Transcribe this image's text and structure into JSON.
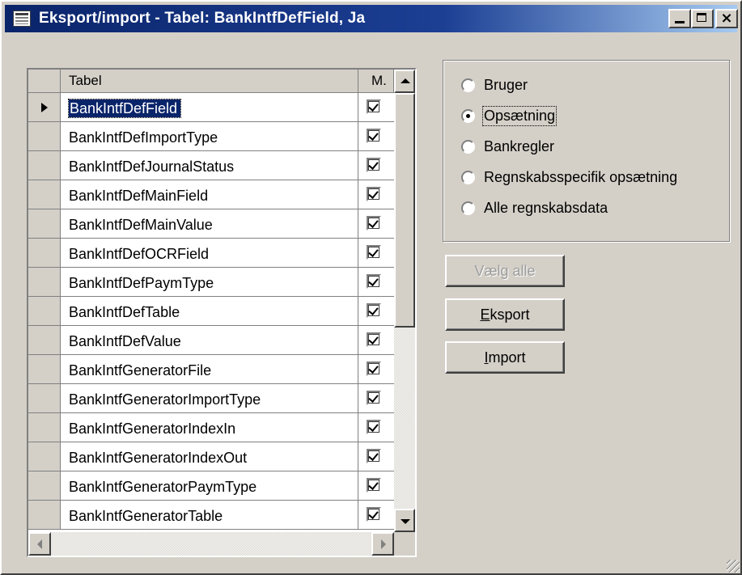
{
  "window": {
    "title": "Eksport/import - Tabel: BankIntfDefField, Ja",
    "controls": {
      "minimize": "_",
      "maximize": "□",
      "close": "×"
    }
  },
  "grid": {
    "columns": {
      "tabel": "Tabel",
      "m": "M."
    },
    "current_row_index": 0,
    "rows": [
      {
        "name": "BankIntfDefField",
        "checked": true
      },
      {
        "name": "BankIntfDefImportType",
        "checked": true
      },
      {
        "name": "BankIntfDefJournalStatus",
        "checked": true
      },
      {
        "name": "BankIntfDefMainField",
        "checked": true
      },
      {
        "name": "BankIntfDefMainValue",
        "checked": true
      },
      {
        "name": "BankIntfDefOCRField",
        "checked": true
      },
      {
        "name": "BankIntfDefPaymType",
        "checked": true
      },
      {
        "name": "BankIntfDefTable",
        "checked": true
      },
      {
        "name": "BankIntfDefValue",
        "checked": true
      },
      {
        "name": "BankIntfGeneratorFile",
        "checked": true
      },
      {
        "name": "BankIntfGeneratorImportType",
        "checked": true
      },
      {
        "name": "BankIntfGeneratorIndexIn",
        "checked": true
      },
      {
        "name": "BankIntfGeneratorIndexOut",
        "checked": true
      },
      {
        "name": "BankIntfGeneratorPaymType",
        "checked": true
      },
      {
        "name": "BankIntfGeneratorTable",
        "checked": true
      }
    ]
  },
  "options": {
    "selected": "Opsætning",
    "items": [
      {
        "label": "Bruger",
        "selected": false
      },
      {
        "label": "Opsætning",
        "selected": true
      },
      {
        "label": "Bankregler",
        "selected": false
      },
      {
        "label": "Regnskabsspecifik opsætning",
        "selected": false
      },
      {
        "label": "Alle regnskabsdata",
        "selected": false
      }
    ]
  },
  "buttons": {
    "select_all": "Vælg alle",
    "export_hotkey": "E",
    "export_rest": "ksport",
    "import_hotkey": "I",
    "import_rest": "mport"
  }
}
